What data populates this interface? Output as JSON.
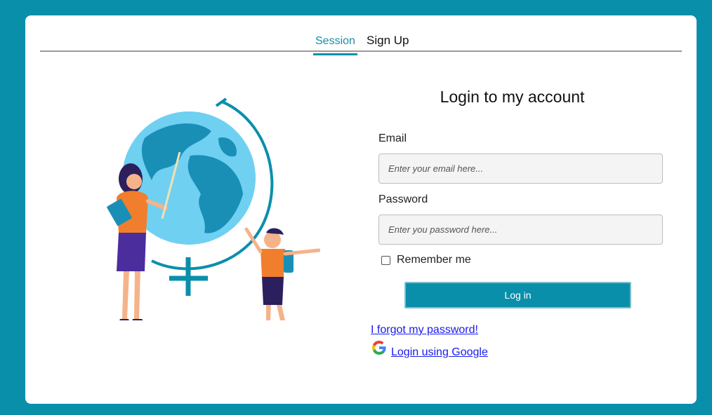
{
  "tabs": [
    {
      "label": "Session",
      "active": true
    },
    {
      "label": "Sign Up",
      "active": false
    }
  ],
  "login": {
    "title": "Login to my account",
    "email_label": "Email",
    "email_placeholder": "Enter your email here...",
    "email_value": "",
    "password_label": "Password",
    "password_placeholder": "Enter you password here...",
    "password_value": "",
    "remember_label": "Remember me",
    "remember_checked": false,
    "submit_label": "Log in",
    "forgot_link": "I forgot my password!",
    "google_link": "Login using Google"
  },
  "colors": {
    "background": "#0a8fab",
    "accent": "#0a8fab",
    "link": "#1a1aee"
  },
  "icons": {
    "google": "google-logo-icon",
    "illustration": "teacher-student-globe-illustration"
  }
}
